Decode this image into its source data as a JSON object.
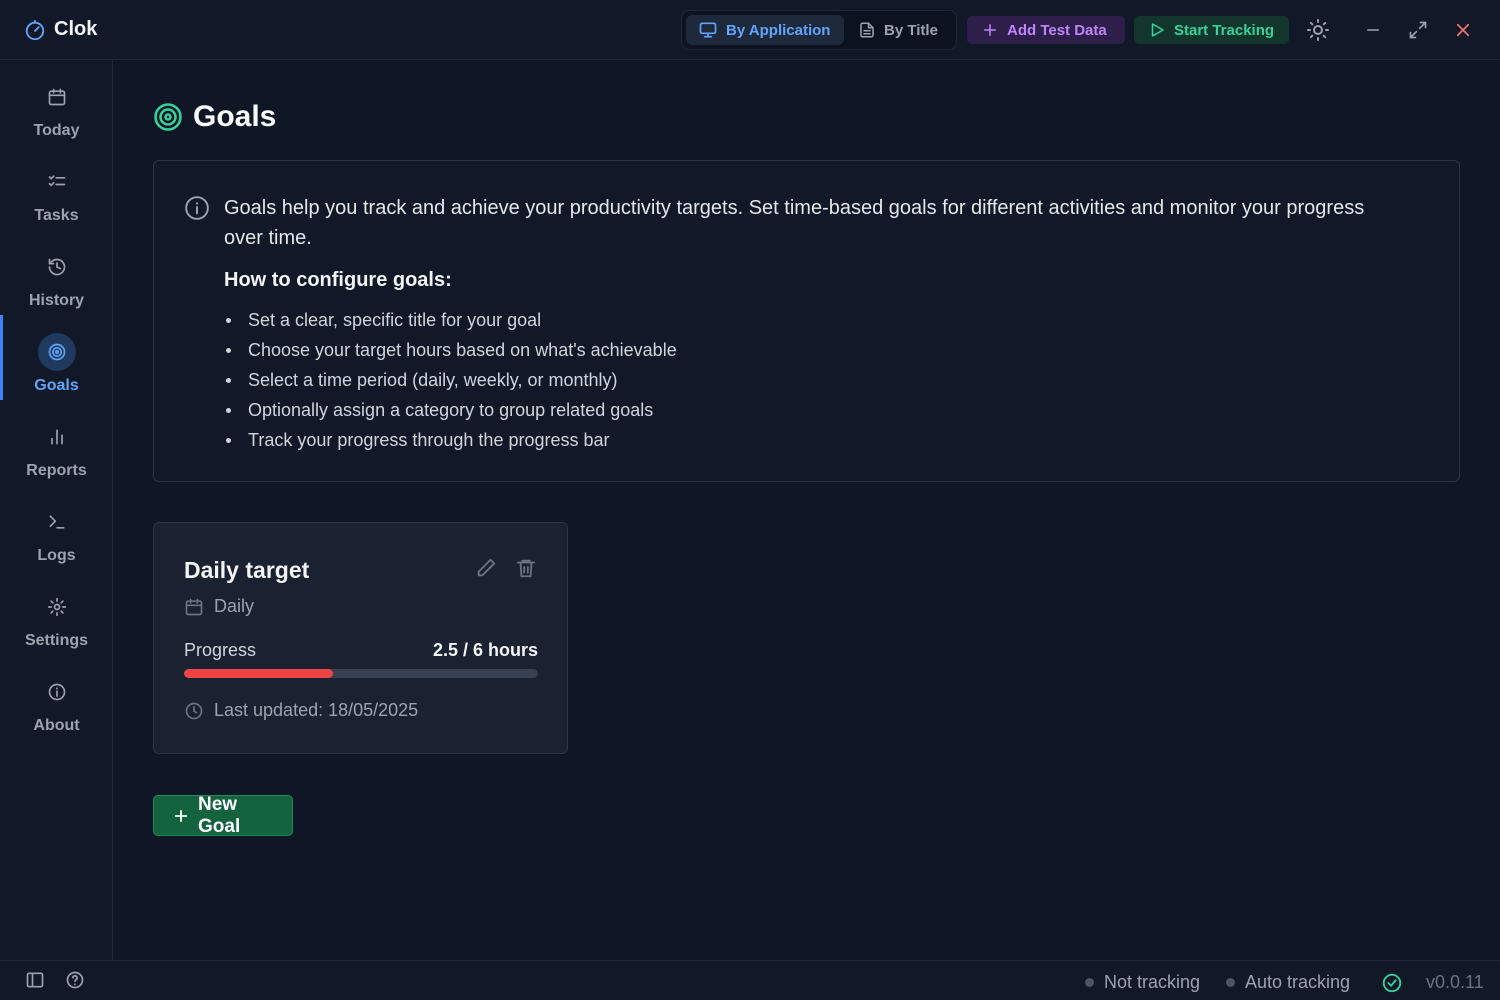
{
  "app": {
    "name": "Clok",
    "logo_icon": "clock-logo-icon"
  },
  "titlebar": {
    "view_modes": [
      {
        "label": "By Application",
        "icon": "monitor-icon",
        "active": true
      },
      {
        "label": "By Title",
        "icon": "document-icon",
        "active": false
      }
    ],
    "add_test_data_label": "Add Test Data",
    "start_tracking_label": "Start Tracking"
  },
  "sidebar": {
    "items": [
      {
        "label": "Today",
        "icon": "calendar-icon"
      },
      {
        "label": "Tasks",
        "icon": "list-checks-icon"
      },
      {
        "label": "History",
        "icon": "history-icon"
      },
      {
        "label": "Goals",
        "icon": "target-icon",
        "active": true
      },
      {
        "label": "Reports",
        "icon": "bar-chart-icon"
      },
      {
        "label": "Logs",
        "icon": "terminal-icon"
      },
      {
        "label": "Settings",
        "icon": "gear-icon"
      },
      {
        "label": "About",
        "icon": "info-icon"
      }
    ]
  },
  "page": {
    "title": "Goals"
  },
  "info": {
    "text": "Goals help you track and achieve your productivity targets. Set time-based goals for different activities and monitor your progress over time.",
    "subtitle": "How to configure goals:",
    "steps": [
      "Set a clear, specific title for your goal",
      "Choose your target hours based on what's achievable",
      "Select a time period (daily, weekly, or monthly)",
      "Optionally assign a category to group related goals",
      "Track your progress through the progress bar"
    ]
  },
  "goal": {
    "title": "Daily target",
    "period": "Daily",
    "progress_label": "Progress",
    "progress_value": "2.5 / 6 hours",
    "progress_fraction": 0.42,
    "last_updated": "Last updated: 18/05/2025"
  },
  "new_goal_label": "New Goal",
  "status": {
    "tracking": "Not tracking",
    "auto": "Auto tracking",
    "version": "v0.0.11"
  },
  "colors": {
    "accent": "#60a5fa",
    "progress": "#ef4444",
    "success": "#34d399",
    "purple": "#c084fc"
  }
}
